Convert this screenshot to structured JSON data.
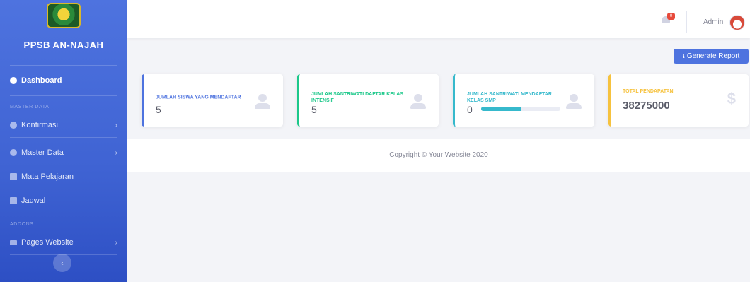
{
  "sidebar": {
    "brand_name": "PPSB AN-NAJAH",
    "dashboard_label": "Dashboard",
    "section_master": "MASTER DATA",
    "section_addons": "ADDONS",
    "items": [
      {
        "label": "Konfirmasi",
        "chevron": "›"
      },
      {
        "label": "Master Data",
        "chevron": "›"
      },
      {
        "label": "Mata Pelajaran"
      },
      {
        "label": "Jadwal"
      },
      {
        "label": "Pages Website",
        "chevron": "›"
      }
    ],
    "toggle_icon": "‹"
  },
  "topbar": {
    "notification_count": "0",
    "user_name": "Admin"
  },
  "header": {
    "generate_label": "Generate Report",
    "generate_icon": "⭳"
  },
  "cards": [
    {
      "label": "JUMLAH SISWA YANG MENDAFTAR",
      "value": "5",
      "color": "#4e73df",
      "icon": "user-icon"
    },
    {
      "label": "JUMLAH SANTRIWATI DAFTAR KELAS INTENSIF",
      "value": "5",
      "color": "#1cc88a",
      "icon": "user-icon"
    },
    {
      "label": "JUMLAH SANTRIWATI MENDAFTAR KELAS SMP",
      "value": "0",
      "color": "#36b9cc",
      "icon": "user-icon",
      "progress_percent": 50
    },
    {
      "label": "TOTAL PENDAPATAN",
      "value": "38275000",
      "color": "#f6c23e",
      "icon": "dollar-icon"
    }
  ],
  "dollar_glyph": "$",
  "footer": {
    "copyright": "Copyright © Your Website 2020"
  }
}
